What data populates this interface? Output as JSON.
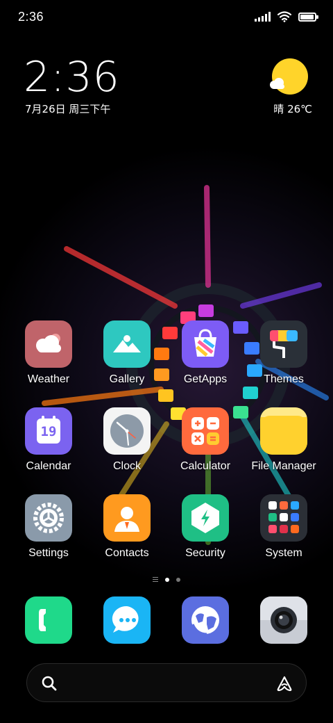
{
  "status_bar": {
    "time": "2:36",
    "battery_level": 0.95
  },
  "clock_widget": {
    "time": "2:36",
    "date": "7月26日 周三下午"
  },
  "weather_widget": {
    "text": "晴 26℃",
    "icon": "sun-cloud-icon"
  },
  "apps": [
    {
      "label": "Weather",
      "icon": "weather-cloud-icon",
      "color": "#c0646a"
    },
    {
      "label": "Gallery",
      "icon": "gallery-mountain-icon",
      "color": "#2ec8c0"
    },
    {
      "label": "GetApps",
      "icon": "shopping-bag-icon",
      "color": "#7d5cf5"
    },
    {
      "label": "Themes",
      "icon": "paint-roller-icon",
      "color": "#2a3038"
    },
    {
      "label": "Calendar",
      "icon": "calendar-icon",
      "color": "#7b63f0",
      "day": "19"
    },
    {
      "label": "Clock",
      "icon": "clock-icon",
      "color": "#f4f4f4"
    },
    {
      "label": "Calculator",
      "icon": "calculator-icon",
      "color": "#ff6a3d"
    },
    {
      "label": "File Manager",
      "icon": "folder-icon",
      "color": "#ffd12e"
    },
    {
      "label": "Settings",
      "icon": "gear-icon",
      "color": "#8a9aaa"
    },
    {
      "label": "Contacts",
      "icon": "person-icon",
      "color": "#ff9a1f"
    },
    {
      "label": "Security",
      "icon": "shield-bolt-icon",
      "color": "#1fbf85"
    },
    {
      "label": "System",
      "icon": "folder-grid-icon",
      "color": "#2b2f36"
    }
  ],
  "dock": [
    {
      "name": "phone",
      "icon": "phone-icon",
      "color": "#1fd98a"
    },
    {
      "name": "messages",
      "icon": "chat-bubble-icon",
      "color": "#1ab5f5"
    },
    {
      "name": "browser",
      "icon": "globe-icon",
      "color": "#5b6ee0"
    },
    {
      "name": "camera",
      "icon": "camera-lens-icon",
      "color": "#c8ccd4"
    }
  ],
  "page_indicator": {
    "pages": 2,
    "current": 1
  },
  "search_bar": {
    "left_icon": "search-icon",
    "right_icon": "assistant-icon"
  }
}
